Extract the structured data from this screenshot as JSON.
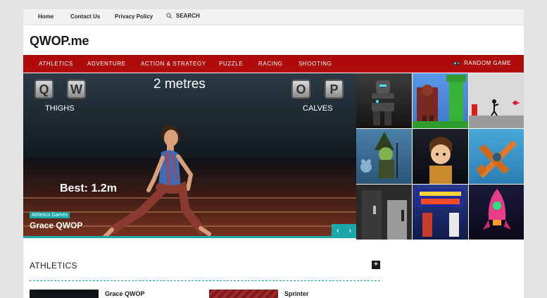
{
  "topnav": {
    "links": [
      "Home",
      "Contact Us",
      "Privacy Policy"
    ],
    "search_label": "SEARCH"
  },
  "site": {
    "logo": "QWOP.me"
  },
  "categories": [
    "ATHLETICS",
    "ADVENTURE",
    "ACTION & STRATEGY",
    "PUZZLE",
    "RACING",
    "SHOOTING"
  ],
  "random_game_label": "RANDOM GAME",
  "hero": {
    "keys": [
      "Q",
      "W",
      "O",
      "P"
    ],
    "key_labels": [
      "THIGHS",
      "CALVES"
    ],
    "distance": "2 metres",
    "best": "Best: 1.2m",
    "badge": "Athletics Games",
    "title": "Grace QWOP",
    "prev_glyph": "‹",
    "next_glyph": "›"
  },
  "section": {
    "title": "ATHLETICS",
    "plus": "+",
    "posts": [
      {
        "title": "Grace QWOP"
      },
      {
        "title": "Sprinter"
      }
    ]
  },
  "colors": {
    "accent_teal": "#1aa8a8",
    "nav_red": "#b00b0b"
  }
}
